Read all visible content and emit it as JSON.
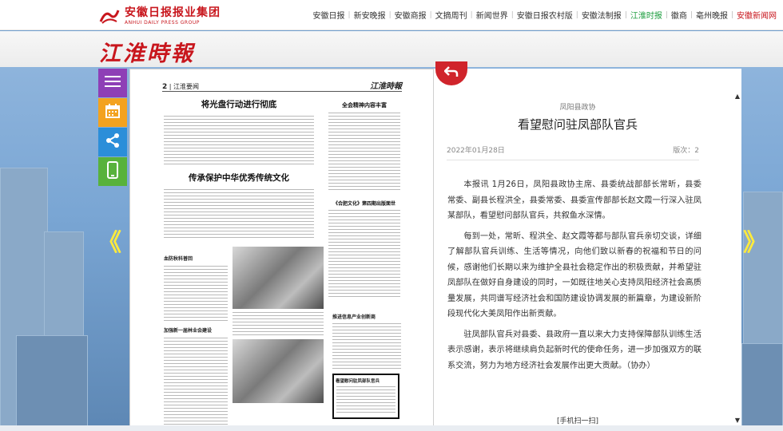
{
  "header": {
    "logo_text": "安徽日报报业集团",
    "logo_subtext": "ANHUI DAILY PRESS GROUP",
    "nav": [
      {
        "label": "安徽日报",
        "style": "normal"
      },
      {
        "label": "新安晚报",
        "style": "normal"
      },
      {
        "label": "安徽商报",
        "style": "normal"
      },
      {
        "label": "文摘周刊",
        "style": "normal"
      },
      {
        "label": "新闻世界",
        "style": "normal"
      },
      {
        "label": "安徽日报农村版",
        "style": "normal"
      },
      {
        "label": "安徽法制报",
        "style": "normal"
      },
      {
        "label": "江淮时报",
        "style": "active"
      },
      {
        "label": "徽商",
        "style": "normal"
      },
      {
        "label": "亳州晚报",
        "style": "normal"
      },
      {
        "label": "安徽新闻网",
        "style": "red"
      }
    ]
  },
  "masthead": {
    "title": "江淮時報"
  },
  "sidebar": {
    "menu_icon": "hamburger-menu-icon",
    "calendar_icon": "calendar-icon",
    "share_icon": "share-icon",
    "phone_icon": "mobile-phone-icon"
  },
  "pager": {
    "prev": "《",
    "next": "》"
  },
  "paper": {
    "page_no": "2",
    "section": "江淮要闻",
    "brand": "江淮時報",
    "headline_1": "将光盘行动进行彻底",
    "headline_2": "传承保护中华优秀传统文化",
    "headline_3": "全会精神内容丰富",
    "headline_4": "《合肥文化》第四期出版面世",
    "headline_5": "血防秋科普回",
    "headline_6": "加强新一届林业会建设",
    "headline_7": "推进信息产业创新商",
    "headline_8": "看望慰问驻凤部队官兵"
  },
  "article": {
    "kicker": "凤阳县政协",
    "title": "看望慰问驻凤部队官兵",
    "date": "2022年01月28日",
    "edition": "版次：2",
    "paragraphs": [
      "本报讯 1月26日，凤阳县政协主席、县委统战部部长常昕，县委常委、副县长程洪全，县委常委、县委宣传部部长赵文霞一行深入驻凤某部队，看望慰问部队官兵，共叙鱼水深情。",
      "每到一处，常昕、程洪全、赵文霞等都与部队官兵亲切交谈，详细了解部队官兵训练、生活等情况，向他们致以新春的祝福和节日的问候，感谢他们长期以来为维护全县社会稳定作出的积极贡献，并希望驻凤部队在做好自身建设的同时，一如既往地关心支持凤阳经济社会高质量发展，共同谱写经济社会和国防建设协调发展的新篇章，为建设新阶段现代化大美凤阳作出新贡献。",
      "驻凤部队官兵对县委、县政府一直以来大力支持保障部队训练生活表示感谢，表示将继续肩负起新时代的使命任务，进一步加强双方的联系交流，努力为地方经济社会发展作出更大贡献。（协办）"
    ],
    "qr_label": "[手机扫一扫]",
    "scroll_up": "▲",
    "scroll_down": "▼"
  },
  "colors": {
    "brand_red": "#c8161d",
    "nav_active": "#1a9c3c",
    "menu_purple": "#8e3fb6",
    "calendar_orange": "#f3a21f",
    "share_blue": "#2b8ed9",
    "phone_green": "#58b23c",
    "arrow_yellow": "#ffeb3b"
  }
}
